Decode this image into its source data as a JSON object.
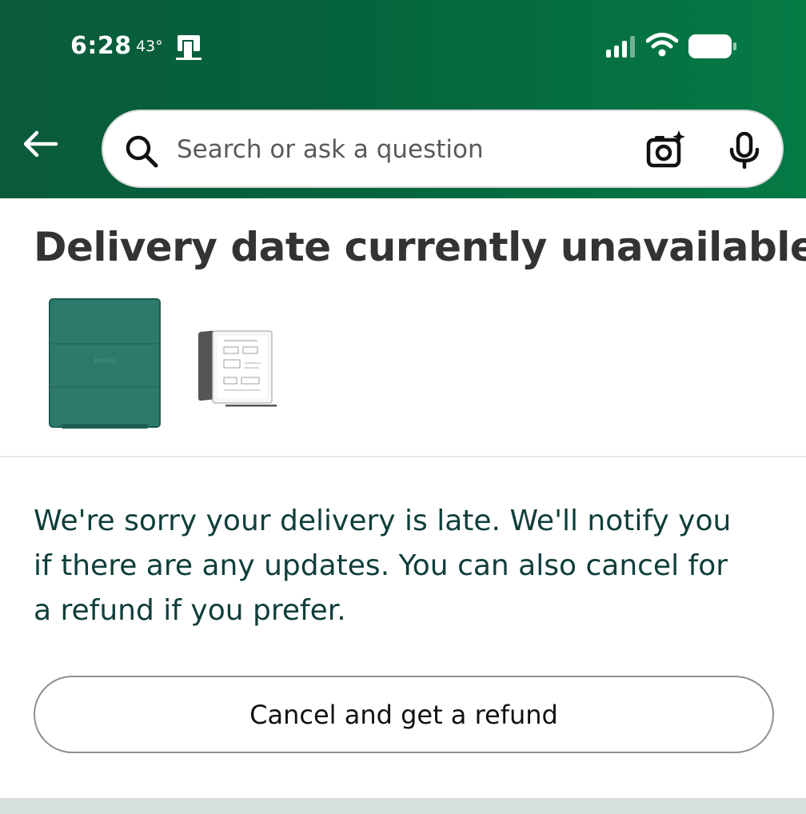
{
  "status_bar": {
    "time": "6:28",
    "temperature": "43°",
    "icons": [
      "app-notification-icon",
      "signal-icon",
      "wifi-icon",
      "battery-icon"
    ]
  },
  "header": {
    "back_icon": "arrow-left-icon",
    "search": {
      "placeholder": "Search or ask a question",
      "value": "",
      "icons": [
        "search-icon",
        "camera-sparkle-icon",
        "microphone-icon"
      ]
    },
    "gradient_colors": [
      "#0a5a3c",
      "#057a45"
    ]
  },
  "main": {
    "title": "Delivery date currently unavailable",
    "products": [
      {
        "name": "kindle-cover",
        "color": "#2c7a6b"
      },
      {
        "name": "kindle-scribe-device"
      }
    ],
    "message": "We're sorry your delivery is late. We'll notify you if there are any updates. You can also cancel for a refund if you prefer.",
    "refund_button_label": "Cancel and get a refund"
  },
  "colors": {
    "text_dark": "#333333",
    "message_text": "#0f3e3a",
    "divider": "#e6e6e6",
    "button_border": "#8f8f8f"
  }
}
